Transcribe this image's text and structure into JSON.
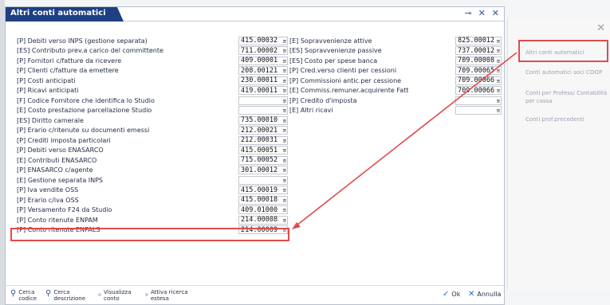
{
  "dialog": {
    "title": "Altri conti automatici",
    "icons": [
      "pin-icon",
      "collapse-icon",
      "close-icon"
    ]
  },
  "left_rows": [
    {
      "label": "[P] Debiti verso INPS (gestione separata)",
      "value": "415.00032"
    },
    {
      "label": "[ES] Contributo prev.a carico del committente",
      "value": "711.00002"
    },
    {
      "label": "[P] Fornitori c/fatture da ricevere",
      "value": "409.00001"
    },
    {
      "label": "[P] Clienti c/fatture da emettere",
      "value": "208.00121"
    },
    {
      "label": "[P] Costi anticipati",
      "value": "230.00011"
    },
    {
      "label": "[P] Ricavi anticipati",
      "value": "419.00011"
    },
    {
      "label": "[F] Codice Fornitore che identifica lo Studio",
      "value": ""
    },
    {
      "label": "[E] Costo prestazione parcellazione Studio",
      "value": ""
    },
    {
      "label": "[ES] Diritto camerale",
      "value": "735.00010"
    },
    {
      "label": "[P] Erario c/ritenute su documenti emessi",
      "value": "212.00021"
    },
    {
      "label": "[P] Crediti imposta particolari",
      "value": "212.00031"
    },
    {
      "label": "[P] Debiti verso ENASARCO",
      "value": "415.00051"
    },
    {
      "label": "[E] Contributi ENASARCO",
      "value": "715.00052"
    },
    {
      "label": "[P] ENASARCO c/agente",
      "value": "301.00012"
    },
    {
      "label": "[E] Gestione separata INPS",
      "value": ""
    },
    {
      "label": "[P] Iva vendite OSS",
      "value": "415.00019"
    },
    {
      "label": "[P] Erario c/iva OSS",
      "value": "415.00018"
    },
    {
      "label": "[P] Versamento F24 da Studio",
      "value": "409.01000"
    },
    {
      "label": "[P] Conto ritenute ENPAM",
      "value": "214.00008"
    },
    {
      "label": "[P] Conto ritenute ENPALS",
      "value": "214.00009"
    }
  ],
  "right_rows": [
    {
      "label": "[E] Sopravvenienze attive",
      "value": "825.00012"
    },
    {
      "label": "[ES] Sopravvenienze passive",
      "value": "737.00012"
    },
    {
      "label": "[ES] Costo per spese banca",
      "value": "709.00008"
    },
    {
      "label": "[P] Cred.verso clienti per cessioni",
      "value": "709.00065"
    },
    {
      "label": "[P] Commissioni antic.per cessione",
      "value": "709.00066"
    },
    {
      "label": "[E] Commiss.remuner.acquirente Fatt",
      "value": "709.00066"
    },
    {
      "label": "[P] Credito d'imposta",
      "value": ""
    },
    {
      "label": "[E] Altri ricavi",
      "value": ""
    }
  ],
  "footer": {
    "cerca_codice": "Cerca codice",
    "cerca_descrizione": "Cerca descrizione",
    "visualizza_conto": "Visualizza conto",
    "attiva_ricerca": "Attiva ricerca estesa",
    "ok": "Ok",
    "annulla": "Annulla"
  },
  "side_panel": {
    "items": [
      "Altri conti automatici",
      "Conti automatici soci COOP",
      "Conti per Profess/ Contabilità per cassa",
      "Conti prof.precedenti"
    ]
  },
  "colors": {
    "title_bg": "#1e3f83",
    "highlight": "#e24a4a",
    "accent": "#2b5797"
  }
}
